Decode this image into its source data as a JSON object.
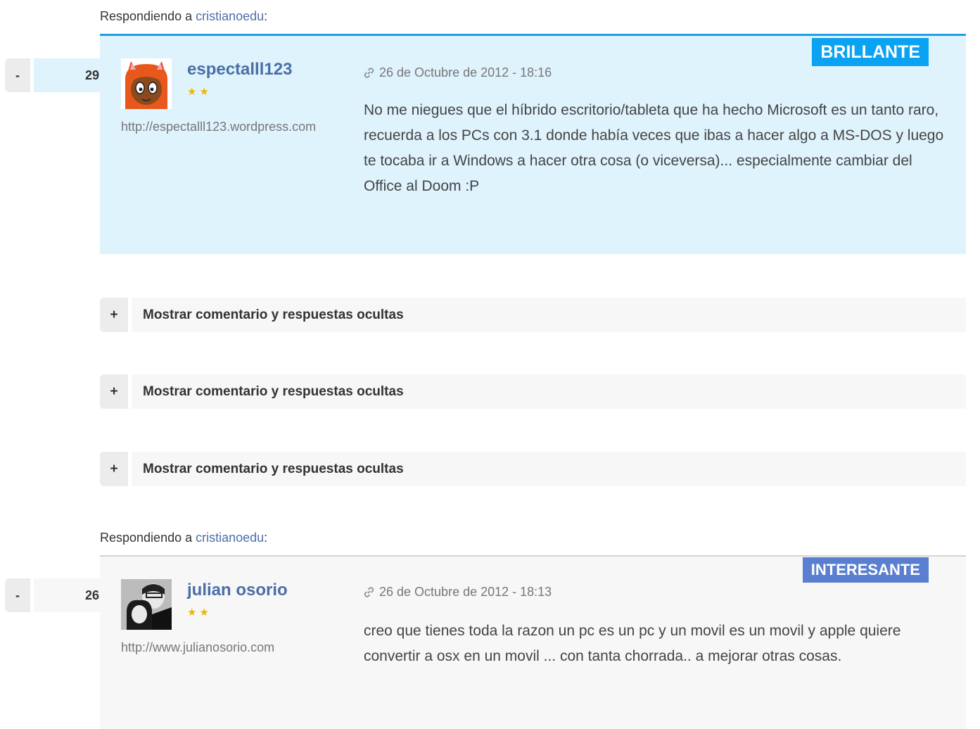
{
  "comments": [
    {
      "reply_prefix": "Respondiendo a ",
      "reply_to": "cristianoedu",
      "reply_suffix": ":",
      "vote_minus": "-",
      "votes": "29",
      "badge": "BRILLANTE",
      "author": "espectalll123",
      "stars": "★★",
      "website": "http://espectalll123.wordpress.com",
      "date": "26 de Octubre de 2012 - 18:16",
      "text": "No me niegues que el híbrido escritorio/tableta que ha hecho Microsoft es un tanto raro, recuerda a los PCs con 3.1 donde había veces que ibas a hacer algo a MS-DOS y luego te tocaba ir a Windows a hacer otra cosa (o viceversa)... especialmente cambiar del Office al Doom :P"
    },
    {
      "reply_prefix": "Respondiendo a ",
      "reply_to": "cristianoedu",
      "reply_suffix": ":",
      "vote_minus": "-",
      "votes": "26",
      "badge": "INTERESANTE",
      "author": "julian osorio",
      "stars": "★★",
      "website": "http://www.julianosorio.com",
      "date": "26 de Octubre de 2012 - 18:13",
      "text": "creo que tienes toda la razon un pc es un pc y un movil es un movil y apple quiere convertir a osx en un movil ... con tanta chorrada.. a mejorar otras cosas."
    }
  ],
  "hidden_rows": [
    {
      "plus": "+",
      "label": "Mostrar comentario y respuestas ocultas"
    },
    {
      "plus": "+",
      "label": "Mostrar comentario y respuestas ocultas"
    },
    {
      "plus": "+",
      "label": "Mostrar comentario y respuestas ocultas"
    }
  ],
  "colors": {
    "brillante_badge": "#0aa2f2",
    "interesante_badge": "#5a7fd1",
    "brillante_bg": "#dff3fd",
    "link": "#4f6ea8",
    "star": "#f0b400"
  },
  "icons": {
    "permalink": "link-icon"
  }
}
